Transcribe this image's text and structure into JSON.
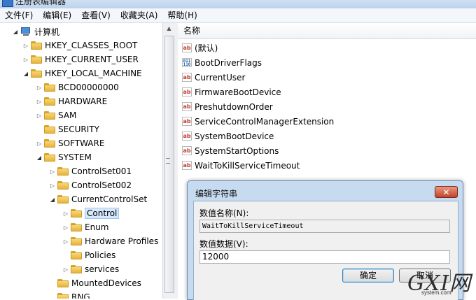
{
  "window": {
    "title": "注册表编辑器"
  },
  "menu": [
    "文件(F)",
    "编辑(E)",
    "查看(V)",
    "收藏夹(A)",
    "帮助(H)"
  ],
  "tree": [
    {
      "label": "计算机",
      "level": 0,
      "state": "open",
      "icon": "computer"
    },
    {
      "label": "HKEY_CLASSES_ROOT",
      "level": 1,
      "state": "closed"
    },
    {
      "label": "HKEY_CURRENT_USER",
      "level": 1,
      "state": "closed"
    },
    {
      "label": "HKEY_LOCAL_MACHINE",
      "level": 1,
      "state": "open"
    },
    {
      "label": "BCD00000000",
      "level": 2,
      "state": "closed"
    },
    {
      "label": "HARDWARE",
      "level": 2,
      "state": "closed"
    },
    {
      "label": "SAM",
      "level": 2,
      "state": "closed"
    },
    {
      "label": "SECURITY",
      "level": 2,
      "state": "none"
    },
    {
      "label": "SOFTWARE",
      "level": 2,
      "state": "closed"
    },
    {
      "label": "SYSTEM",
      "level": 2,
      "state": "open"
    },
    {
      "label": "ControlSet001",
      "level": 3,
      "state": "closed"
    },
    {
      "label": "ControlSet002",
      "level": 3,
      "state": "closed"
    },
    {
      "label": "CurrentControlSet",
      "level": 3,
      "state": "open"
    },
    {
      "label": "Control",
      "level": 4,
      "state": "closed",
      "selected": true
    },
    {
      "label": "Enum",
      "level": 4,
      "state": "closed"
    },
    {
      "label": "Hardware Profiles",
      "level": 4,
      "state": "closed"
    },
    {
      "label": "Policies",
      "level": 4,
      "state": "none"
    },
    {
      "label": "services",
      "level": 4,
      "state": "closed"
    },
    {
      "label": "MountedDevices",
      "level": 3,
      "state": "none"
    },
    {
      "label": "RNG",
      "level": 3,
      "state": "none"
    }
  ],
  "list": {
    "column_name": "名称",
    "values": [
      {
        "name": "(默认)",
        "type": "string"
      },
      {
        "name": "BootDriverFlags",
        "type": "binary"
      },
      {
        "name": "CurrentUser",
        "type": "string"
      },
      {
        "name": "FirmwareBootDevice",
        "type": "string"
      },
      {
        "name": "PreshutdownOrder",
        "type": "string"
      },
      {
        "name": "ServiceControlManagerExtension",
        "type": "string"
      },
      {
        "name": "SystemBootDevice",
        "type": "string"
      },
      {
        "name": "SystemStartOptions",
        "type": "string"
      },
      {
        "name": "WaitToKillServiceTimeout",
        "type": "string"
      }
    ]
  },
  "dialog": {
    "title": "编辑字符串",
    "close_label": "✕",
    "name_label": "数值名称(N):",
    "name_value": "WaitToKillServiceTimeout",
    "data_label": "数值数据(V):",
    "data_value": "12000",
    "ok_label": "确定",
    "cancel_label": "取消"
  },
  "watermark": {
    "big": "GXI网",
    "small": "system.com"
  }
}
